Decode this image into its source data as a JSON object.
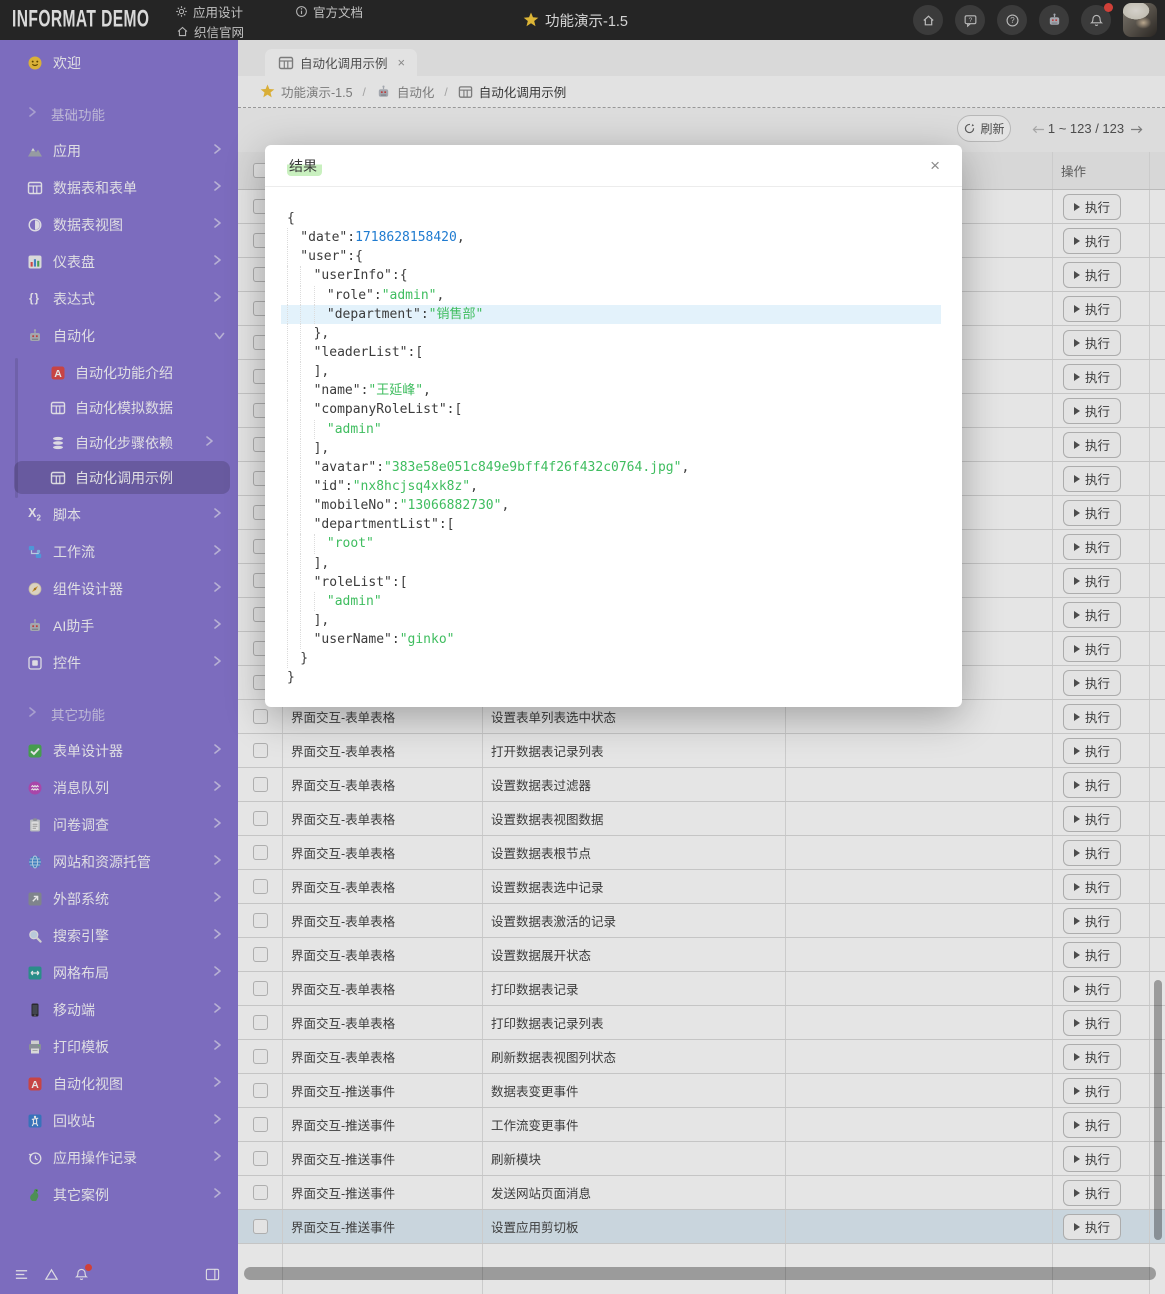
{
  "topbar": {
    "logo": "INFORMAT DEMO",
    "menu": [
      {
        "icon": "gear",
        "label": "应用设计"
      },
      {
        "icon": "info",
        "label": "官方文档"
      },
      {
        "icon": "home-outline",
        "label": "织信官网"
      }
    ],
    "title": "功能演示-1.5",
    "actions": [
      {
        "icon": "home"
      },
      {
        "icon": "message"
      },
      {
        "icon": "help"
      },
      {
        "icon": "robot"
      },
      {
        "icon": "bell",
        "badge": true
      }
    ]
  },
  "sidebar": {
    "items": [
      {
        "type": "item",
        "icon": "smiley",
        "label": "欢迎"
      },
      {
        "type": "section",
        "label": "基础功能"
      },
      {
        "type": "item",
        "icon": "mountain",
        "label": "应用",
        "chev": "right"
      },
      {
        "type": "item",
        "icon": "grid",
        "label": "数据表和表单",
        "chev": "right"
      },
      {
        "type": "item",
        "icon": "pie",
        "label": "数据表视图",
        "chev": "right"
      },
      {
        "type": "item",
        "icon": "chart",
        "label": "仪表盘",
        "chev": "right"
      },
      {
        "type": "item",
        "icon": "braces",
        "label": "表达式",
        "chev": "right"
      },
      {
        "type": "item",
        "icon": "robot-color",
        "label": "自动化",
        "chev": "down"
      },
      {
        "type": "sub",
        "icon": "a-red",
        "label": "自动化功能介绍"
      },
      {
        "type": "sub",
        "icon": "grid",
        "label": "自动化模拟数据"
      },
      {
        "type": "sub",
        "icon": "db",
        "label": "自动化步骤依赖",
        "chev": "right"
      },
      {
        "type": "sub",
        "icon": "grid",
        "label": "自动化调用示例",
        "active": true
      },
      {
        "type": "item",
        "icon": "script",
        "label": "脚本",
        "chev": "right"
      },
      {
        "type": "item",
        "icon": "workflow",
        "label": "工作流",
        "chev": "right"
      },
      {
        "type": "item",
        "icon": "compass",
        "label": "组件设计器",
        "chev": "right"
      },
      {
        "type": "item",
        "icon": "robot-color",
        "label": "AI助手",
        "chev": "right"
      },
      {
        "type": "item",
        "icon": "widget",
        "label": "控件",
        "chev": "right"
      },
      {
        "type": "section",
        "label": "其它功能"
      },
      {
        "type": "item",
        "icon": "check",
        "label": "表单设计器",
        "chev": "right"
      },
      {
        "type": "item",
        "icon": "queue",
        "label": "消息队列",
        "chev": "right"
      },
      {
        "type": "item",
        "icon": "clipboard",
        "label": "问卷调查",
        "chev": "right"
      },
      {
        "type": "item",
        "icon": "globe",
        "label": "网站和资源托管",
        "chev": "right"
      },
      {
        "type": "item",
        "icon": "external",
        "label": "外部系统",
        "chev": "right"
      },
      {
        "type": "item",
        "icon": "search",
        "label": "搜索引擎",
        "chev": "right"
      },
      {
        "type": "item",
        "icon": "gridlayout",
        "label": "网格布局",
        "chev": "right"
      },
      {
        "type": "item",
        "icon": "phone",
        "label": "移动端",
        "chev": "right"
      },
      {
        "type": "item",
        "icon": "printer",
        "label": "打印模板",
        "chev": "right"
      },
      {
        "type": "item",
        "icon": "a-red",
        "label": "自动化视图",
        "chev": "right"
      },
      {
        "type": "item",
        "icon": "recycle",
        "label": "回收站",
        "chev": "right"
      },
      {
        "type": "item",
        "icon": "history",
        "label": "应用操作记录",
        "chev": "right"
      },
      {
        "type": "item",
        "icon": "dino",
        "label": "其它案例",
        "chev": "right"
      }
    ],
    "footer_icons": [
      "menu",
      "triangle",
      "bell"
    ],
    "footer_right_icon": "collapse"
  },
  "tab": {
    "label": "自动化调用示例",
    "close": "×"
  },
  "breadcrumb": [
    {
      "icon": "star",
      "label": "功能演示-1.5"
    },
    {
      "icon": "robot-color",
      "label": "自动化"
    },
    {
      "icon": "grid-gray",
      "label": "自动化调用示例"
    }
  ],
  "toolbar": {
    "refresh_label": "刷新",
    "pagination": "1 ~ 123 / 123"
  },
  "table": {
    "op_header": "操作",
    "execute_label": "执行",
    "rows": [
      {
        "cat": "",
        "act": ""
      },
      {
        "cat": "",
        "act": ""
      },
      {
        "cat": "",
        "act": ""
      },
      {
        "cat": "",
        "act": ""
      },
      {
        "cat": "",
        "act": ""
      },
      {
        "cat": "",
        "act": ""
      },
      {
        "cat": "",
        "act": ""
      },
      {
        "cat": "",
        "act": ""
      },
      {
        "cat": "",
        "act": ""
      },
      {
        "cat": "",
        "act": ""
      },
      {
        "cat": "",
        "act": ""
      },
      {
        "cat": "",
        "act": ""
      },
      {
        "cat": "",
        "act": ""
      },
      {
        "cat": "",
        "act": ""
      },
      {
        "cat": "",
        "act": ""
      },
      {
        "cat": "界面交互-表单表格",
        "act": "设置表单列表选中状态"
      },
      {
        "cat": "界面交互-表单表格",
        "act": "打开数据表记录列表"
      },
      {
        "cat": "界面交互-表单表格",
        "act": "设置数据表过滤器"
      },
      {
        "cat": "界面交互-表单表格",
        "act": "设置数据表视图数据"
      },
      {
        "cat": "界面交互-表单表格",
        "act": "设置数据表根节点"
      },
      {
        "cat": "界面交互-表单表格",
        "act": "设置数据表选中记录"
      },
      {
        "cat": "界面交互-表单表格",
        "act": "设置数据表激活的记录"
      },
      {
        "cat": "界面交互-表单表格",
        "act": "设置数据展开状态"
      },
      {
        "cat": "界面交互-表单表格",
        "act": "打印数据表记录"
      },
      {
        "cat": "界面交互-表单表格",
        "act": "打印数据表记录列表"
      },
      {
        "cat": "界面交互-表单表格",
        "act": "刷新数据表视图列状态"
      },
      {
        "cat": "界面交互-推送事件",
        "act": "数据表变更事件"
      },
      {
        "cat": "界面交互-推送事件",
        "act": "工作流变更事件"
      },
      {
        "cat": "界面交互-推送事件",
        "act": "刷新模块"
      },
      {
        "cat": "界面交互-推送事件",
        "act": "发送网站页面消息"
      },
      {
        "cat": "界面交互-推送事件",
        "act": "设置应用剪切板",
        "selected": true
      }
    ]
  },
  "modal": {
    "title": "结果",
    "close": "×",
    "json_lines": [
      {
        "ind": 0,
        "seg": [
          [
            "p",
            "{"
          ]
        ]
      },
      {
        "ind": 1,
        "seg": [
          [
            "k",
            "\"date\""
          ],
          [
            "p",
            ":"
          ],
          [
            "n",
            "1718628158420"
          ],
          [
            "p",
            ","
          ]
        ]
      },
      {
        "ind": 1,
        "seg": [
          [
            "k",
            "\"user\""
          ],
          [
            "p",
            ":{"
          ]
        ]
      },
      {
        "ind": 2,
        "seg": [
          [
            "k",
            "\"userInfo\""
          ],
          [
            "p",
            ":{"
          ]
        ]
      },
      {
        "ind": 3,
        "seg": [
          [
            "k",
            "\"role\""
          ],
          [
            "p",
            ":"
          ],
          [
            "s",
            "\"admin\""
          ],
          [
            "p",
            ","
          ]
        ]
      },
      {
        "ind": 3,
        "seg": [
          [
            "k",
            "\"department\""
          ],
          [
            "p",
            ":"
          ],
          [
            "s",
            "\"销售部\""
          ]
        ],
        "hl": true
      },
      {
        "ind": 2,
        "seg": [
          [
            "p",
            "},"
          ]
        ]
      },
      {
        "ind": 2,
        "seg": [
          [
            "k",
            "\"leaderList\""
          ],
          [
            "p",
            ":["
          ]
        ]
      },
      {
        "ind": 2,
        "seg": [
          [
            "p",
            "],"
          ]
        ]
      },
      {
        "ind": 2,
        "seg": [
          [
            "k",
            "\"name\""
          ],
          [
            "p",
            ":"
          ],
          [
            "s",
            "\"王延峰\""
          ],
          [
            "p",
            ","
          ]
        ]
      },
      {
        "ind": 2,
        "seg": [
          [
            "k",
            "\"companyRoleList\""
          ],
          [
            "p",
            ":["
          ]
        ]
      },
      {
        "ind": 3,
        "seg": [
          [
            "s",
            "\"admin\""
          ]
        ]
      },
      {
        "ind": 2,
        "seg": [
          [
            "p",
            "],"
          ]
        ]
      },
      {
        "ind": 2,
        "seg": [
          [
            "k",
            "\"avatar\""
          ],
          [
            "p",
            ":"
          ],
          [
            "s",
            "\"383e58e051c849e9bff4f26f432c0764.jpg\""
          ],
          [
            "p",
            ","
          ]
        ]
      },
      {
        "ind": 2,
        "seg": [
          [
            "k",
            "\"id\""
          ],
          [
            "p",
            ":"
          ],
          [
            "s",
            "\"nx8hcjsq4xk8z\""
          ],
          [
            "p",
            ","
          ]
        ]
      },
      {
        "ind": 2,
        "seg": [
          [
            "k",
            "\"mobileNo\""
          ],
          [
            "p",
            ":"
          ],
          [
            "s",
            "\"13066882730\""
          ],
          [
            "p",
            ","
          ]
        ]
      },
      {
        "ind": 2,
        "seg": [
          [
            "k",
            "\"departmentList\""
          ],
          [
            "p",
            ":["
          ]
        ]
      },
      {
        "ind": 3,
        "seg": [
          [
            "s",
            "\"root\""
          ]
        ]
      },
      {
        "ind": 2,
        "seg": [
          [
            "p",
            "],"
          ]
        ]
      },
      {
        "ind": 2,
        "seg": [
          [
            "k",
            "\"roleList\""
          ],
          [
            "p",
            ":["
          ]
        ]
      },
      {
        "ind": 3,
        "seg": [
          [
            "s",
            "\"admin\""
          ]
        ]
      },
      {
        "ind": 2,
        "seg": [
          [
            "p",
            "],"
          ]
        ]
      },
      {
        "ind": 2,
        "seg": [
          [
            "k",
            "\"userName\""
          ],
          [
            "p",
            ":"
          ],
          [
            "s",
            "\"ginko\""
          ]
        ]
      },
      {
        "ind": 1,
        "seg": [
          [
            "p",
            "}"
          ]
        ]
      },
      {
        "ind": 0,
        "seg": [
          [
            "p",
            "}"
          ]
        ]
      }
    ]
  }
}
